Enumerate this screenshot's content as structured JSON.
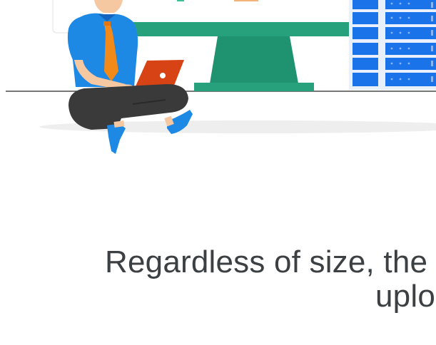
{
  "caption": {
    "line1": "Regardless of size, the",
    "line2": "uplo"
  },
  "colors": {
    "background": "#ffffff",
    "text": "#3c4043",
    "monitor_green": "#26a17b",
    "shirt_blue": "#1e88e5",
    "tie_orange": "#f28a1a",
    "laptop_orange": "#d84315",
    "pants_gray": "#3a3a3a",
    "server_blue": "#1a73e8",
    "shadow_gray": "#eeeeee"
  },
  "icons": [
    "person-icon",
    "laptop-icon",
    "monitor-icon",
    "server-rack-icon"
  ]
}
